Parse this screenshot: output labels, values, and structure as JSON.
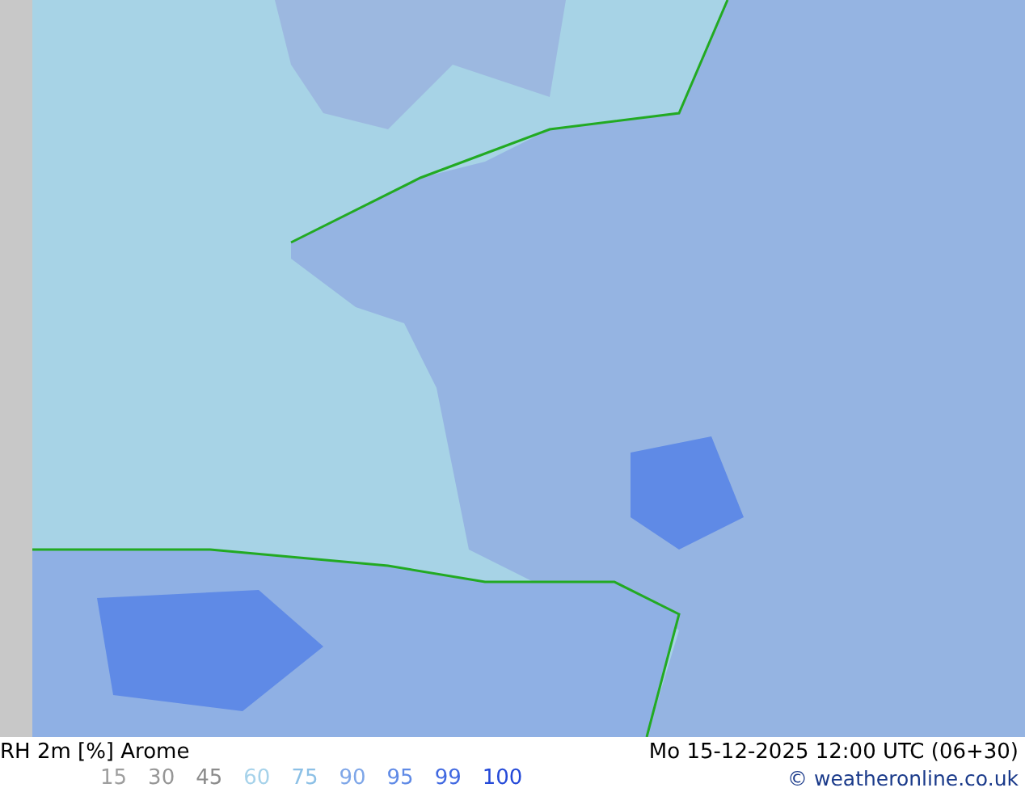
{
  "map": {
    "kind": "humidity-map"
  },
  "footer": {
    "title": "RH 2m [%] Arome",
    "datetime": "Mo 15-12-2025 12:00 UTC (06+30)",
    "credit": "© weatheronline.co.uk",
    "legend": [
      {
        "label": "15",
        "color": "#9e9e9e"
      },
      {
        "label": "30",
        "color": "#969696"
      },
      {
        "label": "45",
        "color": "#8c8c8c"
      },
      {
        "label": "60",
        "color": "#a6d2ea"
      },
      {
        "label": "75",
        "color": "#8cc0e6"
      },
      {
        "label": "90",
        "color": "#7ea6e8"
      },
      {
        "label": "95",
        "color": "#5f8ae6"
      },
      {
        "label": "99",
        "color": "#4169e1"
      },
      {
        "label": "100",
        "color": "#2449d8"
      }
    ]
  }
}
